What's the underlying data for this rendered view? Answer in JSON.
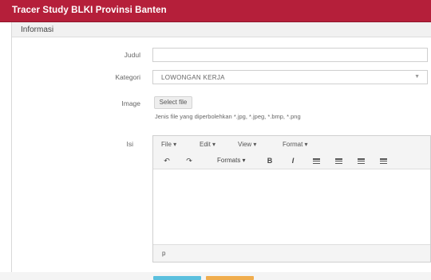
{
  "app": {
    "title": "Tracer Study BLKI Provinsi Banten"
  },
  "panel": {
    "heading": "Informasi"
  },
  "form": {
    "judul_label": "Judul",
    "judul_value": "",
    "kategori_label": "Kategori",
    "kategori_value": "LOWONGAN KERJA",
    "image_label": "Image",
    "select_file_label": "Select file",
    "image_help": "Jenis file yang diperbolehkan *.jpg, *.jpeg, *.bmp, *.png",
    "isi_label": "Isi"
  },
  "editor": {
    "menu": [
      "File ▾",
      "Edit ▾",
      "View ▾",
      "Format ▾"
    ],
    "formats_label": "Formats ▾",
    "undo": "↶",
    "redo": "↷",
    "bold": "B",
    "italic": "I",
    "status_path": "p"
  },
  "buttons": {
    "save_color": "#5bc0de",
    "reset_color": "#f0ad4e"
  },
  "colors": {
    "header": "#b51f3a"
  }
}
